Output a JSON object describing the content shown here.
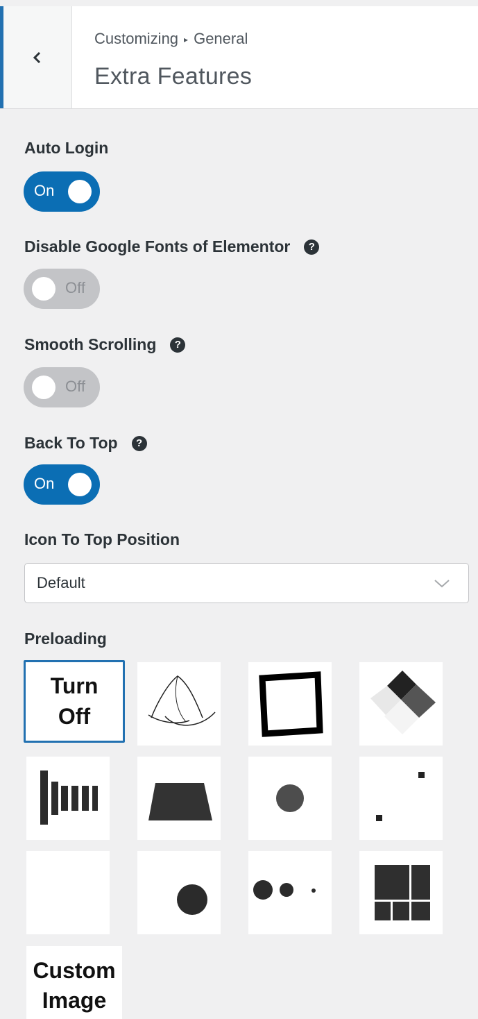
{
  "header": {
    "breadcrumb_parent": "Customizing",
    "breadcrumb_sep": "▸",
    "breadcrumb_child": "General",
    "title": "Extra Features"
  },
  "settings": {
    "auto_login": {
      "label": "Auto Login",
      "state": "On"
    },
    "disable_google_fonts": {
      "label": "Disable Google Fonts of Elementor",
      "state": "Off"
    },
    "smooth_scrolling": {
      "label": "Smooth Scrolling",
      "state": "Off"
    },
    "back_to_top": {
      "label": "Back To Top",
      "state": "On"
    },
    "icon_position": {
      "label": "Icon To Top Position",
      "value": "Default"
    }
  },
  "preloading": {
    "label": "Preloading",
    "turn_off": [
      "Turn",
      "Off"
    ],
    "custom_image": [
      "Custom",
      "Image"
    ]
  },
  "colors": {
    "accent": "#2271b1",
    "toggle_on": "#0b6eb4",
    "toggle_off": "#c3c4c7"
  }
}
